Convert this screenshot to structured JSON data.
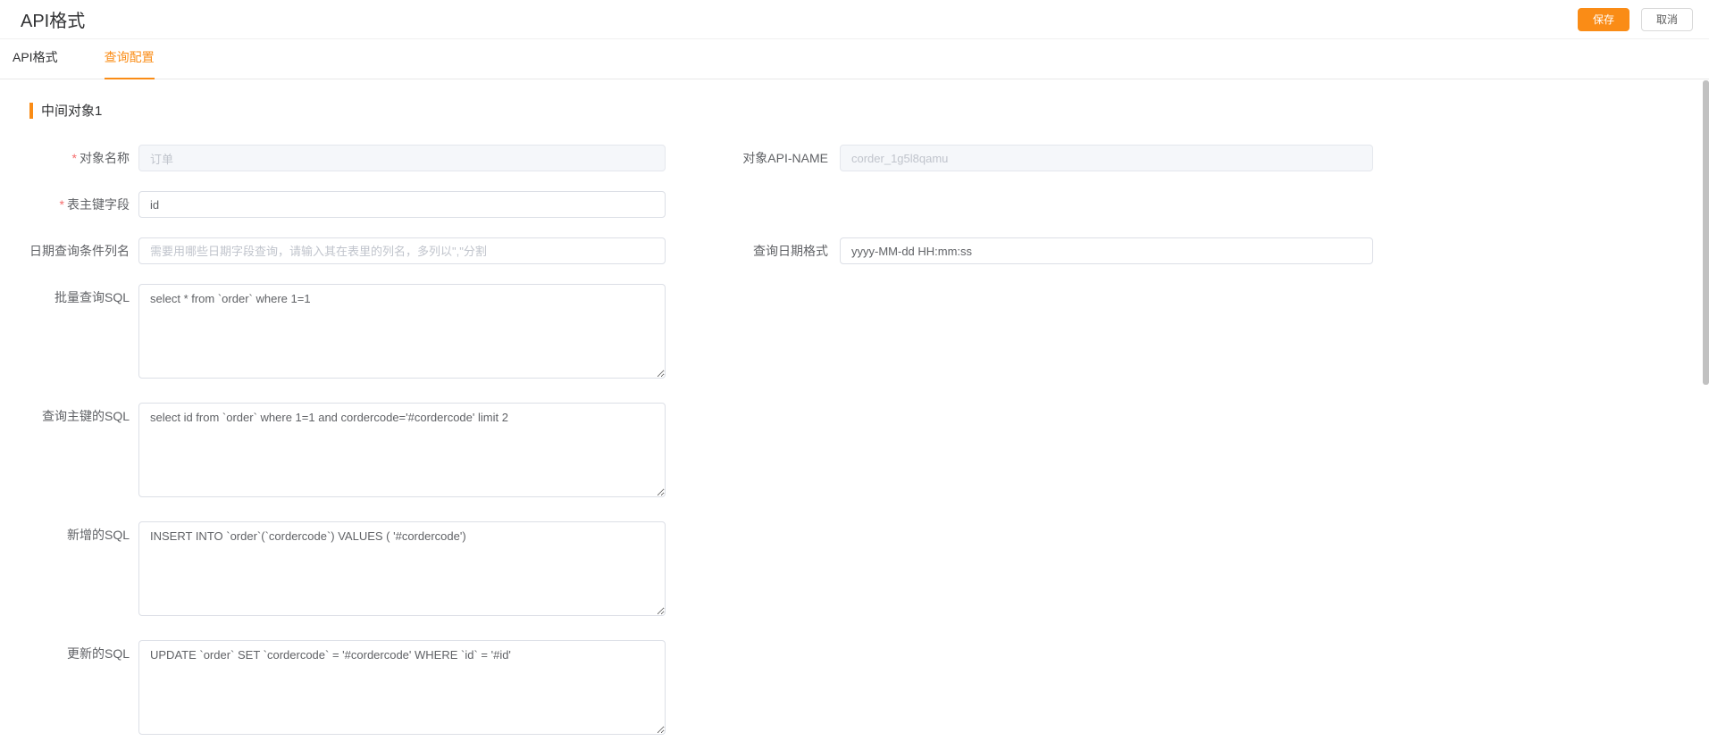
{
  "colors": {
    "accent": "#fa8c16",
    "required": "#f56c6c",
    "scrollbar_thumb": "#c1c1c1"
  },
  "header": {
    "title": "API格式",
    "save_label": "保存",
    "cancel_label": "取消"
  },
  "tabs": [
    {
      "label": "API格式",
      "active": false
    },
    {
      "label": "查询配置",
      "active": true
    }
  ],
  "section": {
    "title": "中间对象1"
  },
  "form": {
    "required_mark": "*",
    "object_name": {
      "label": "对象名称",
      "required": true,
      "value": "订单",
      "disabled": true
    },
    "object_api_name": {
      "label": "对象API-NAME",
      "value": "corder_1g5l8qamu",
      "disabled": true
    },
    "primary_key_field": {
      "label": "表主键字段",
      "required": true,
      "value": "id"
    },
    "date_condition_columns": {
      "label": "日期查询条件列名",
      "value": "",
      "placeholder": "需要用哪些日期字段查询，请输入其在表里的列名，多列以\",\"分割"
    },
    "date_format": {
      "label": "查询日期格式",
      "value": "yyyy-MM-dd HH:mm:ss"
    },
    "batch_query_sql": {
      "label": "批量查询SQL",
      "value": "select * from `order` where 1=1"
    },
    "query_pk_sql": {
      "label": "查询主键的SQL",
      "value": "select id from `order` where 1=1 and cordercode='#cordercode' limit 2"
    },
    "insert_sql": {
      "label": "新增的SQL",
      "value": "INSERT INTO `order`(`cordercode`) VALUES ( '#cordercode')"
    },
    "update_sql": {
      "label": "更新的SQL",
      "value": "UPDATE `order` SET `cordercode` = '#cordercode' WHERE `id` = '#id'"
    }
  }
}
